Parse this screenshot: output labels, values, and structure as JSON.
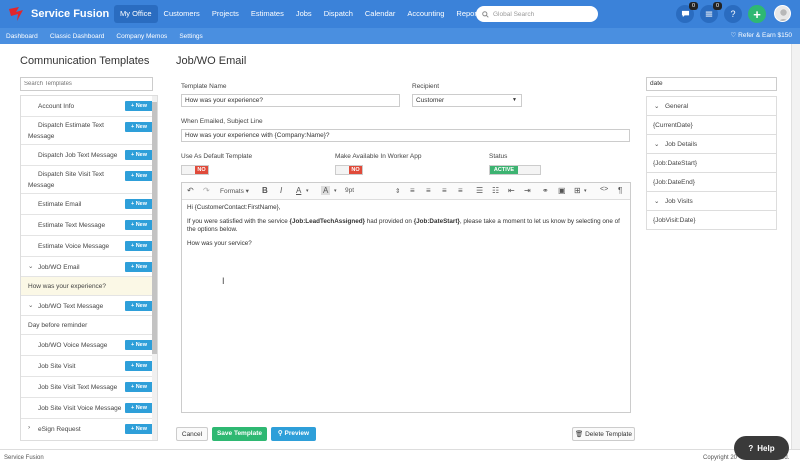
{
  "app": {
    "name": "Service Fusion"
  },
  "topnav": {
    "items": [
      "My Office",
      "Customers",
      "Projects",
      "Estimates",
      "Jobs",
      "Dispatch",
      "Calendar",
      "Accounting",
      "Reports"
    ],
    "search_placeholder": "Global Search",
    "chat_count": "0",
    "tasks_count": "0",
    "help_label": "?",
    "add_label": "+"
  },
  "subnav": {
    "items": [
      "Dashboard",
      "Classic Dashboard",
      "Company Memos",
      "Settings"
    ],
    "refer": "Refer & Earn $150"
  },
  "left": {
    "title": "Communication Templates",
    "search_placeholder": "Search Templates",
    "new_label": "+ New",
    "items": [
      "Account Info",
      "Dispatch Estimate Text Message",
      "Dispatch Job Text Message",
      "Dispatch Site Visit Text Message",
      "Estimate Email",
      "Estimate Text Message",
      "Estimate Voice Message",
      "Job/WO Email",
      "How was your experience?",
      "Job/WO Text Message",
      "Day before reminder",
      "Job/WO Voice Message",
      "Job Site Visit",
      "Job Site Visit Text Message",
      "Job Site Visit Voice Message",
      "eSign Request"
    ]
  },
  "main": {
    "title": "Job/WO Email",
    "template_name_label": "Template Name",
    "template_name_value": "How was your experience?",
    "recipient_label": "Recipient",
    "recipient_value": "Customer",
    "subject_label": "When Emailed, Subject Line",
    "subject_value": "How was your experience with {Company:Name}?",
    "default_label": "Use As Default Template",
    "default_value": "NO",
    "worker_label": "Make Available In Worker App",
    "worker_value": "NO",
    "status_label": "Status",
    "status_value": "ACTIVE",
    "toolbar_formats": "Formats",
    "toolbar_fontsize": "9pt",
    "body_greeting": "Hi {CustomerContact:FirstName},",
    "body_p1_a": "If you were satisfied with the service ",
    "body_p1_b": "{Job:LeadTechAssigned}",
    "body_p1_c": " had provided on ",
    "body_p1_d": "{Job:DateStart}",
    "body_p1_e": ", please take a moment to let us know by selecting one of the options below.",
    "body_p2": "How was your service?",
    "cancel": "Cancel",
    "save": "Save Template",
    "preview": "Preview",
    "delete": "Delete Template"
  },
  "right": {
    "search_value": "date",
    "sections": [
      {
        "name": "General",
        "items": [
          "{CurrentDate}"
        ]
      },
      {
        "name": "Job Details",
        "items": [
          "{Job:DateStart}",
          "{Job:DateEnd}"
        ]
      },
      {
        "name": "Job Visits",
        "items": [
          "{JobVisit:Date}"
        ]
      }
    ]
  },
  "footer": {
    "left": "Service Fusion",
    "right": "Copyright 20",
    "right_tail": "ved."
  },
  "help_widget": "Help",
  "colors": {
    "primary": "#3b82d9",
    "green": "#2eb872",
    "new_btn": "#2e9fd9",
    "no_red": "#e04a3a"
  }
}
